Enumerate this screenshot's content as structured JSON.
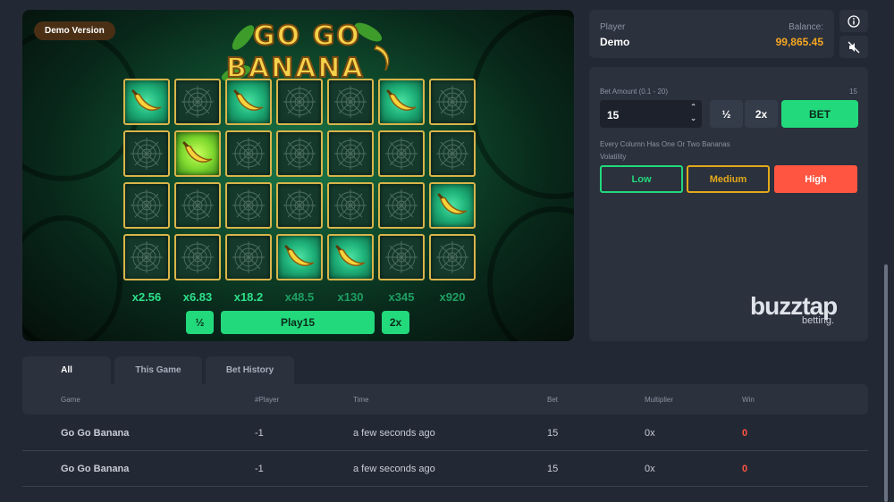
{
  "game": {
    "demo_badge": "Demo Version",
    "logo": {
      "line1": "GO GO",
      "line2": "BANANA"
    },
    "grid": [
      [
        "banana",
        "web",
        "banana",
        "web",
        "web",
        "banana",
        "web"
      ],
      [
        "web",
        "banana-lit",
        "web",
        "web",
        "web",
        "web",
        "web"
      ],
      [
        "web",
        "web",
        "web",
        "web",
        "web",
        "web",
        "banana"
      ],
      [
        "web",
        "web",
        "web",
        "banana",
        "banana",
        "web",
        "web"
      ]
    ],
    "multipliers": [
      "x2.56",
      "x6.83",
      "x18.2",
      "x48.5",
      "x130",
      "x345",
      "x920"
    ],
    "half_label": "½",
    "play_label": "Play15",
    "double_label": "2x"
  },
  "player": {
    "player_label": "Player",
    "player_name": "Demo",
    "balance_label": "Balance:",
    "balance_value": "99,865.45"
  },
  "icons": {
    "info": "info-icon",
    "sound": "mute-icon"
  },
  "bet": {
    "amount_label": "Bet Amount (0.1 - 20)",
    "amount_right": "15",
    "amount_value": "15",
    "half_label": "½",
    "double_label": "2x",
    "bet_label": "BET",
    "note": "Every Column Has One Or Two Bananas",
    "volatility_label": "Volatility",
    "volatility": [
      "Low",
      "Medium",
      "High"
    ],
    "selected_volatility": "High"
  },
  "brand": {
    "name": "buzztap",
    "sub": "betting."
  },
  "colors": {
    "accent": "#22d97c",
    "medium": "#e3a91b",
    "high": "#ff5541",
    "balance": "#f5a623"
  },
  "history": {
    "tabs": [
      "All",
      "This Game",
      "Bet History"
    ],
    "columns": [
      "Game",
      "#Player",
      "Time",
      "Bet",
      "Multiplier",
      "Win"
    ],
    "rows": [
      {
        "game": "Go Go Banana",
        "player": "-1",
        "time": "a few seconds ago",
        "bet": "15",
        "multiplier": "0x",
        "win": "0"
      },
      {
        "game": "Go Go Banana",
        "player": "-1",
        "time": "a few seconds ago",
        "bet": "15",
        "multiplier": "0x",
        "win": "0"
      }
    ]
  }
}
